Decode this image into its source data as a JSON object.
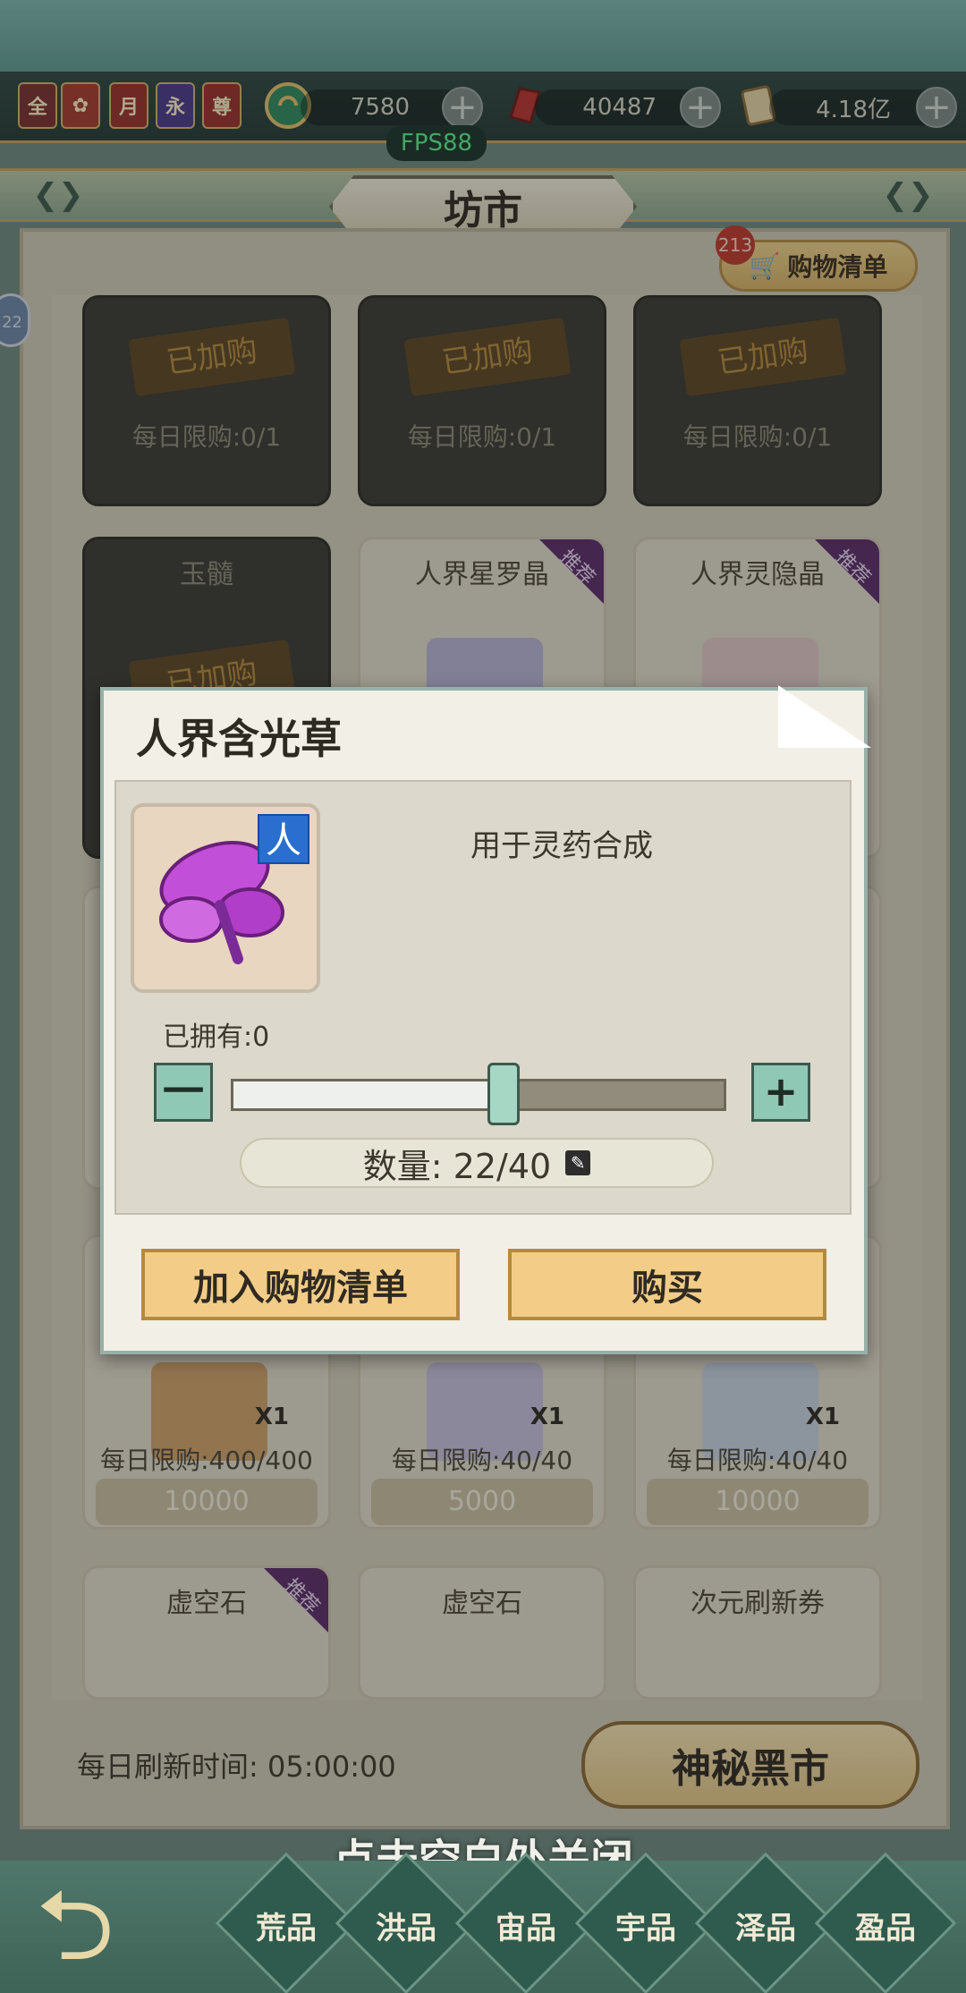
{
  "resources": {
    "jade": "7580",
    "crystal": "40487",
    "scroll": "4.18亿"
  },
  "badges": [
    "全",
    "",
    "月",
    "永",
    "尊"
  ],
  "fps": "FPS88",
  "header": {
    "title": "坊市"
  },
  "cart": {
    "count": "213",
    "label": "购物清单"
  },
  "side_badge": "22",
  "shop": {
    "row1": [
      {
        "stamp": "已加购",
        "limit": "每日限购:0/1"
      },
      {
        "stamp": "已加购",
        "limit": "每日限购:0/1"
      },
      {
        "stamp": "已加购",
        "limit": "每日限购:0/1"
      }
    ],
    "row2": [
      {
        "name": "玉髓",
        "stamp": "已加购"
      },
      {
        "name": "人界星罗晶",
        "tag": "推荐"
      },
      {
        "name": "人界灵隐晶",
        "tag": "推荐"
      }
    ],
    "row4": [
      {
        "x": "X1",
        "limit": "每日限购:400/400",
        "price": "10000"
      },
      {
        "x": "X1",
        "limit": "每日限购:40/40",
        "price": "5000"
      },
      {
        "x": "X1",
        "limit": "每日限购:40/40",
        "price": "10000"
      }
    ],
    "row5": [
      {
        "name": "虚空石",
        "tag": "推荐"
      },
      {
        "name": "虚空石"
      },
      {
        "name": "次元刷新券"
      }
    ]
  },
  "refresh": {
    "label": "每日刷新时间:",
    "time": "05:00:00"
  },
  "black_market_button": "神秘黑市",
  "modal": {
    "title": "人界含光草",
    "badge": "人",
    "description": "用于灵药合成",
    "owned": "已拥有:0",
    "minus": "一",
    "plus": "+",
    "quantity": "数量: 22/40",
    "quantity_value": 22,
    "quantity_max": 40,
    "add_to_cart": "加入购物清单",
    "buy": "购买"
  },
  "close_hint": "点击空白处关闭",
  "nav": [
    "荒品",
    "洪品",
    "宙品",
    "宇品",
    "泽品",
    "盈品"
  ],
  "colors": {
    "accent_gold": "#f3cd87",
    "teal_button": "#8fc9b5",
    "recommend_tag": "#5a2c6b"
  }
}
